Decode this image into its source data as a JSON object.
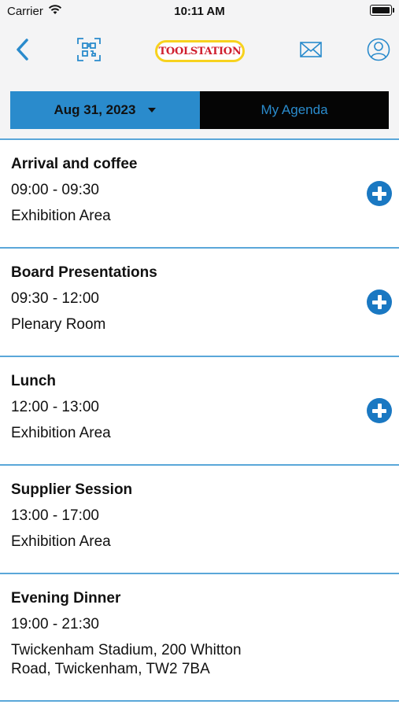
{
  "status_bar": {
    "carrier": "Carrier",
    "time": "10:11 AM"
  },
  "header": {
    "logo_text": "TOOLSTATION",
    "icons": [
      "back-chevron-icon",
      "qr-scan-icon",
      "mail-icon",
      "profile-icon"
    ]
  },
  "segment": {
    "date_label": "Aug 31, 2023",
    "agenda_label": "My Agenda",
    "selected": "date"
  },
  "colors": {
    "accent": "#2a8bcc",
    "divider": "#5aa7d9",
    "add_button": "#1a78c2",
    "logo_red": "#d0202f",
    "logo_yellow": "#f7d21e"
  },
  "sessions": [
    {
      "title": "Arrival and coffee",
      "time": "09:00 - 09:30",
      "location": "Exhibition Area",
      "addable": true
    },
    {
      "title": "Board Presentations",
      "time": "09:30 - 12:00",
      "location": "Plenary Room",
      "addable": true
    },
    {
      "title": "Lunch",
      "time": "12:00 - 13:00",
      "location": "Exhibition Area",
      "addable": true
    },
    {
      "title": "Supplier Session",
      "time": "13:00 - 17:00",
      "location": "Exhibition Area",
      "addable": false
    },
    {
      "title": "Evening Dinner",
      "time": "19:00 - 21:30",
      "location_lines": [
        "Twickenham Stadium, 200 Whitton",
        "Road, Twickenham, TW2 7BA"
      ],
      "addable": false
    }
  ]
}
